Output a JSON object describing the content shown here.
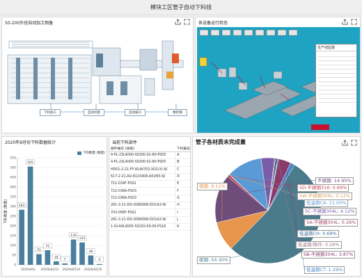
{
  "app": {
    "title": "模块工区管子自动下料线"
  },
  "panel_line": {
    "title": "50-200外径自动加工制备",
    "buttons": [
      "下料加工",
      "自动切割",
      "自动坡口",
      "数控钢"
    ]
  },
  "panel_device": {
    "title": "各设备运行状态",
    "popup_title": "生产线监督"
  },
  "panel_bar": {
    "title": "2020年8月份下料数据统计",
    "legend": "下料数量 (数量)",
    "ylabel": "下料数量 (数量)"
  },
  "panel_table": {
    "title": "当前下料部件",
    "columns": [
      "部件编号 (规格)",
      "下料编号"
    ],
    "rows": [
      [
        "4-PL-23L4000-SS300-02-80-PS05",
        "A"
      ],
      [
        "4-PL-23L4000-SS300-02-80-PS05",
        "B"
      ],
      [
        "HD01-2-21-FF-8140702-XO2(3)-N/",
        "C"
      ],
      [
        "617-2-21-AU-8110408-A01M3-N/",
        "D"
      ],
      [
        "711-034F-PS02",
        "E"
      ],
      [
        "722-036A-PS03",
        "F"
      ],
      [
        "722-036A-PS03",
        "G"
      ],
      [
        "281-3-21-DO-9380068-DO1A3-N/",
        "H"
      ],
      [
        "703-006F-PS01",
        "I"
      ],
      [
        "281-3-21-DO-9380068-DO1A3-N/",
        "J"
      ],
      [
        "1-GI-64L0005-SS150-00-00-PS18",
        "K"
      ]
    ]
  },
  "panel_pie": {
    "title": "管子各材质未完成量"
  },
  "icons": {
    "export": "export-icon",
    "fullscreen": "fullscreen-icon"
  },
  "chart_data": [
    {
      "type": "bar",
      "title": "2020年8月份下料数据统计",
      "ylabel": "下料数量 (数量)",
      "x_tick_labels": [
        "2020年8月",
        "2020年8月12",
        "2020年8月16",
        "2020年8月20"
      ],
      "values": [
        283,
        505,
        55,
        75,
        18,
        7,
        130,
        115,
        48,
        4
      ],
      "value_labels": [
        "283",
        "505",
        "55",
        "75",
        "18",
        "7",
        "130",
        "115",
        "48",
        "4"
      ],
      "ylim": [
        0,
        550
      ],
      "yticks": [
        0,
        50,
        100,
        150,
        200,
        250,
        300,
        350,
        400,
        450,
        500,
        550
      ],
      "legend": "下料数量 (数量)",
      "color": "#4a7fa0"
    },
    {
      "type": "pie",
      "title": "管子各材质未完成量",
      "slices": [
        {
          "label": "碳钢",
          "value": 54.3,
          "text": "碳钢: 54.30%",
          "color": "#4a7b8a"
        },
        {
          "label": "铜镍",
          "value": 9.11,
          "text": "铜镍: 9.11%",
          "color": "#e8954e"
        },
        {
          "label": "不锈钢",
          "value": 14.95,
          "text": "不锈钢: 14.95%",
          "color": "#6e4d7a"
        },
        {
          "label": "SD-不锈钢316",
          "value": 0.69,
          "text": "SD-不锈钢316: 0.69%",
          "color": "#c0465a"
        },
        {
          "label": "SW-不锈钢304L",
          "value": 0.12,
          "text": "SW-不锈钢304L: 0.12%",
          "color": "#d9a060"
        },
        {
          "label": "低温钢CA",
          "value": 11.0,
          "text": "低温钢CA: 11.00%",
          "color": "#5b9bd5"
        },
        {
          "label": "SC-不锈钢304L",
          "value": 4.12,
          "text": "SC-不锈钢304L: 4.12%",
          "color": "#7a5ca8"
        },
        {
          "label": "SA-不锈钢304L",
          "value": 0.26,
          "text": "SA-不锈钢304L: 0.26%",
          "color": "#a04868"
        },
        {
          "label": "低温钢CH",
          "value": 0.69,
          "text": "低温钢CH: 0.69%",
          "color": "#3a6a9a"
        },
        {
          "label": "低温钢/铸件",
          "value": 0.26,
          "text": "低温钢/铸件: 0.26%",
          "color": "#9a7a8a"
        },
        {
          "label": "SB-不锈钢304L",
          "value": 3.87,
          "text": "SB-不锈钢304L: 3.87%",
          "color": "#8a3a6a"
        },
        {
          "label": "低温钢CT",
          "value": 1.29,
          "text": "低温钢CT: 1.29%",
          "color": "#4a86c8"
        }
      ]
    }
  ]
}
